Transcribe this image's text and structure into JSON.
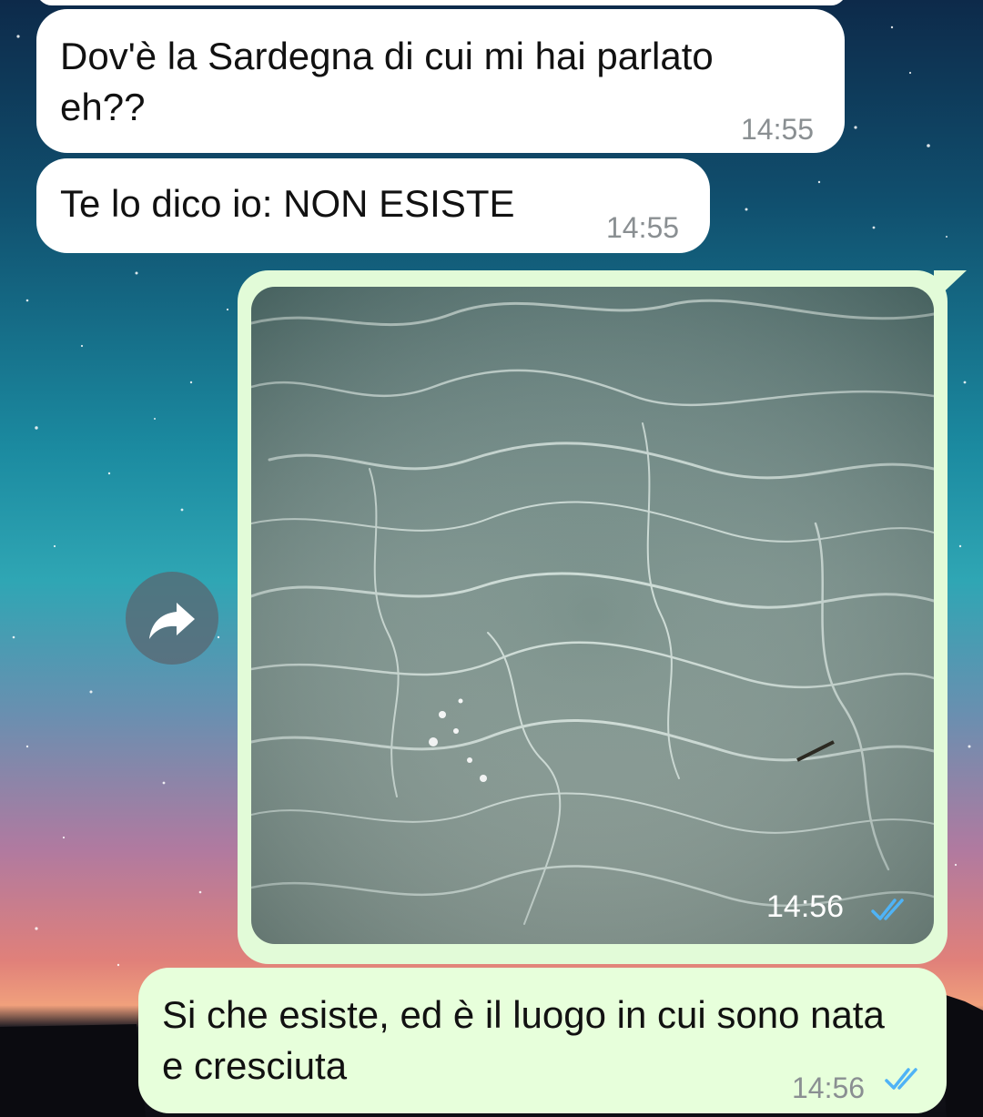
{
  "messages": [
    {
      "text": "Dov'è la Sardegna di cui mi hai parlato eh??",
      "time": "14:55"
    },
    {
      "text": "Te lo dico io: NON ESISTE",
      "time": "14:55"
    },
    {
      "type": "image",
      "alt": "",
      "time": "14:56",
      "status": "read"
    },
    {
      "text": "Si che esiste, ed è il luogo in cui sono nata e cresciuta",
      "time": "14:56",
      "status": "read"
    }
  ],
  "colors": {
    "incoming_bubble": "#ffffff",
    "outgoing_bubble": "#e7ffdb",
    "read_ticks": "#4fb3f6",
    "timestamp": "#8a8f92"
  },
  "icons": {
    "forward": "share-forward-icon",
    "status": "double-check-icon"
  }
}
